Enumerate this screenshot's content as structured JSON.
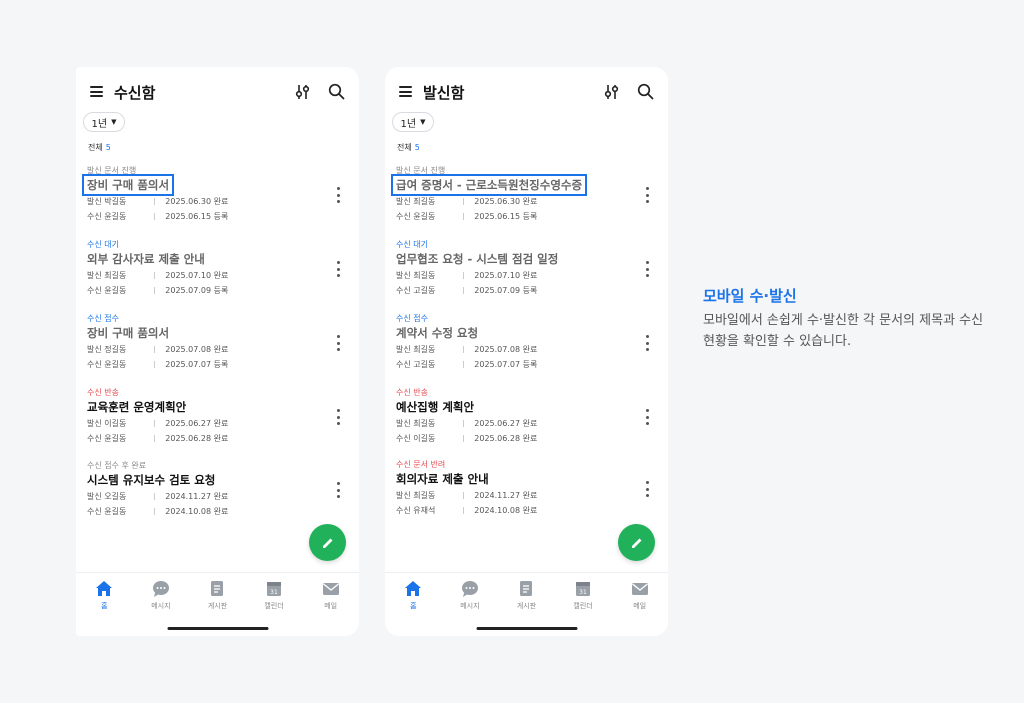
{
  "colors": {
    "accent": "#1a73e8",
    "reject": "#e5484d",
    "fab": "#20b15a"
  },
  "tabs": [
    "홈",
    "메시지",
    "게시판",
    "캘린더",
    "메일"
  ],
  "left": {
    "title": "수신함",
    "period": "1년",
    "total_label": "전체",
    "total_count": "5",
    "items": [
      {
        "status": "발신 문서 진행",
        "title": "장비 구매 품의서",
        "m1_role": "발신",
        "m1_who": "박길동",
        "m1_val": "2025.06.30 완료",
        "m2_role": "수신",
        "m2_who": "윤길동",
        "m2_val": "2025.06.15 등록"
      },
      {
        "status": "수신 대기",
        "title": "외부 감사자료 제출 안내",
        "m1_role": "발신",
        "m1_who": "최길동",
        "m1_val": "2025.07.10 완료",
        "m2_role": "수신",
        "m2_who": "윤길동",
        "m2_val": "2025.07.09 등록"
      },
      {
        "status": "수신 접수",
        "title": "장비 구매 품의서",
        "m1_role": "발신",
        "m1_who": "정길동",
        "m1_val": "2025.07.08 완료",
        "m2_role": "수신",
        "m2_who": "윤길동",
        "m2_val": "2025.07.07 등록"
      },
      {
        "status": "수신 반송",
        "title": "교육훈련 운영계획안",
        "m1_role": "발신",
        "m1_who": "이길동",
        "m1_val": "2025.06.27 완료",
        "m2_role": "수신",
        "m2_who": "윤길동",
        "m2_val": "2025.06.28 완료"
      },
      {
        "status": "수신 접수 후 완료",
        "title": "시스템 유지보수 검토 요청",
        "m1_role": "발신",
        "m1_who": "오길동",
        "m1_val": "2024.11.27 완료",
        "m2_role": "수신",
        "m2_who": "윤길동",
        "m2_val": "2024.10.08 완료"
      }
    ]
  },
  "right": {
    "title": "발신함",
    "period": "1년",
    "total_label": "전체",
    "total_count": "5",
    "items": [
      {
        "status": "발신 문서 진행",
        "title": "급여 증명서 - 근로소득원천징수영수증",
        "m1_role": "발신",
        "m1_who": "최길동",
        "m1_val": "2025.06.30 완료",
        "m2_role": "수신",
        "m2_who": "윤길동",
        "m2_val": "2025.06.15 등록"
      },
      {
        "status": "수신 대기",
        "title": "업무협조 요청 - 시스템 점검 일정",
        "m1_role": "발신",
        "m1_who": "최길동",
        "m1_val": "2025.07.10 완료",
        "m2_role": "수신",
        "m2_who": "고길동",
        "m2_val": "2025.07.09 등록"
      },
      {
        "status": "수신 접수",
        "title": "계약서 수정 요청",
        "m1_role": "발신",
        "m1_who": "최길동",
        "m1_val": "2025.07.08 완료",
        "m2_role": "수신",
        "m2_who": "고길동",
        "m2_val": "2025.07.07 등록"
      },
      {
        "status": "수신 반송",
        "title": "예산집행 계획안",
        "m1_role": "발신",
        "m1_who": "최길동",
        "m1_val": "2025.06.27 완료",
        "m2_role": "수신",
        "m2_who": "이길동",
        "m2_val": "2025.06.28 완료"
      },
      {
        "status": "수신 문서 반려",
        "title": "회의자료 제출 안내",
        "m1_role": "발신",
        "m1_who": "최길동",
        "m1_val": "2024.11.27 완료",
        "m2_role": "수신",
        "m2_who": "유재석",
        "m2_val": "2024.10.08 완료"
      }
    ]
  },
  "caption": {
    "title": "모바일 수·발신",
    "description": "모바일에서 손쉽게 수·발신한 각 문서의 제목과 수신 현황을 확인할 수 있습니다."
  }
}
